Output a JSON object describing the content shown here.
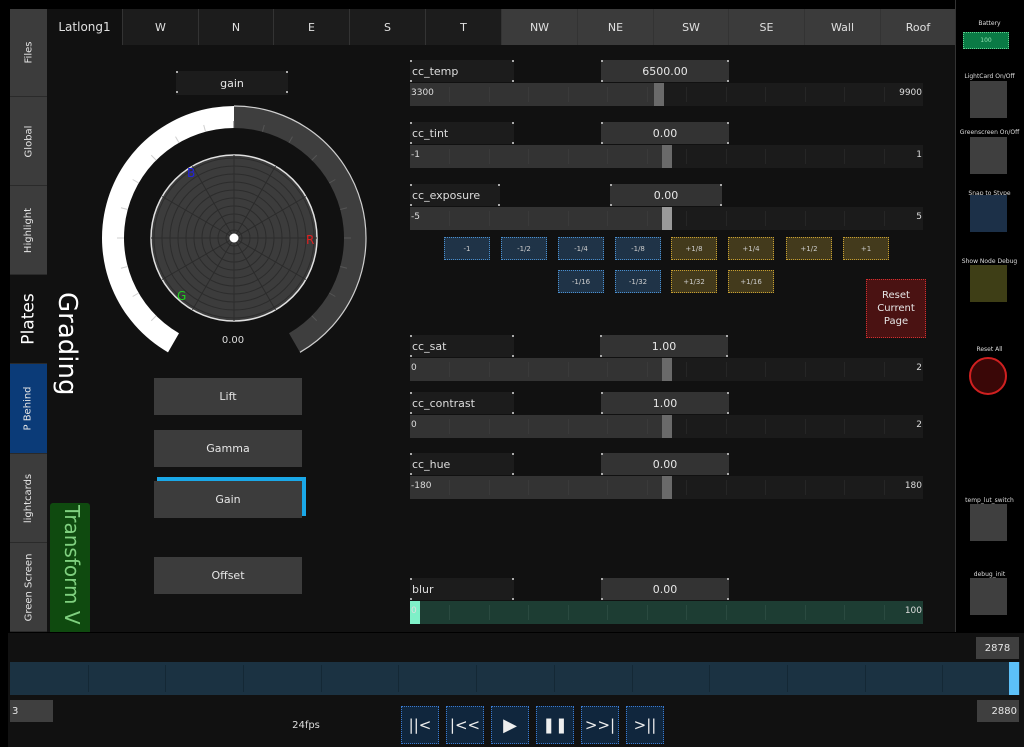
{
  "left_tabs": [
    {
      "label": "Files",
      "state": "normal"
    },
    {
      "label": "Global",
      "state": "normal"
    },
    {
      "label": "Highlight",
      "state": "normal"
    },
    {
      "label": "Plates",
      "state": "active"
    },
    {
      "label": "P Behind",
      "state": "selected"
    },
    {
      "label": "lightcards",
      "state": "normal"
    },
    {
      "label": "Green Screen",
      "state": "normal"
    }
  ],
  "top_tabs": [
    {
      "label": "Latlong1",
      "active": true
    },
    {
      "label": "W"
    },
    {
      "label": "N"
    },
    {
      "label": "E"
    },
    {
      "label": "S"
    },
    {
      "label": "T"
    },
    {
      "label": "NW"
    },
    {
      "label": "NE"
    },
    {
      "label": "SW"
    },
    {
      "label": "SE"
    },
    {
      "label": "Wall"
    },
    {
      "label": "Roof"
    }
  ],
  "section_titles": {
    "grading": "Grading",
    "transform": "Transform V"
  },
  "color_wheel": {
    "mode_label": "gain",
    "value": "0.00",
    "ring_fill_fraction": 0.5,
    "channel_labels": {
      "r": "R",
      "g": "G",
      "b": "B"
    },
    "channel_colors": {
      "r": "#e02020",
      "g": "#20d020",
      "b": "#2020e0"
    }
  },
  "grade_buttons": [
    {
      "label": "Lift",
      "selected": false
    },
    {
      "label": "Gamma",
      "selected": false
    },
    {
      "label": "Gain",
      "selected": true
    },
    {
      "label": "Offset",
      "selected": false
    }
  ],
  "sliders": [
    {
      "name": "cc_temp",
      "value": "6500.00",
      "min": "3300",
      "max": "9900",
      "fraction": 0.485
    },
    {
      "name": "cc_tint",
      "value": "0.00",
      "min": "-1",
      "max": "1",
      "fraction": 0.5
    },
    {
      "name": "cc_exposure",
      "value": "0.00",
      "min": "-5",
      "max": "5",
      "fraction": 0.5
    },
    {
      "name": "cc_sat",
      "value": "1.00",
      "min": "0",
      "max": "2",
      "fraction": 0.5
    },
    {
      "name": "cc_contrast",
      "value": "1.00",
      "min": "0",
      "max": "2",
      "fraction": 0.5
    },
    {
      "name": "cc_hue",
      "value": "0.00",
      "min": "-180",
      "max": "180",
      "fraction": 0.5
    },
    {
      "name": "blur",
      "value": "0.00",
      "min": "0",
      "max": "100",
      "fraction": 0.0
    }
  ],
  "exposure_steps": {
    "row1": [
      "-1",
      "-1/2",
      "-1/4",
      "-1/8",
      "+1/8",
      "+1/4",
      "+1/2",
      "+1"
    ],
    "row2": [
      "-1/16",
      "-1/32",
      "+1/32",
      "+1/16"
    ]
  },
  "reset_page_label": "Reset Current Page",
  "right_panel": {
    "battery_label": "Battery",
    "battery_value": "100",
    "buttons": [
      {
        "label": "LightCard On/Off"
      },
      {
        "label": "Greenscreen On/Off"
      },
      {
        "label": "Snap to Stype"
      },
      {
        "label": "Show Node Debug"
      },
      {
        "label": "Reset All"
      },
      {
        "label": "temp_lut_switch"
      },
      {
        "label": "debug_init"
      }
    ]
  },
  "timeline": {
    "current_frame": "2878",
    "start_frame": "3",
    "end_frame": "2880",
    "fps": "24fps",
    "playhead_fraction": 0.999
  },
  "transport": [
    {
      "label": "||<",
      "icon": "go-to-start-icon"
    },
    {
      "label": "|<<",
      "icon": "step-back-icon"
    },
    {
      "label": "▶",
      "icon": "play-icon"
    },
    {
      "label": "❚❚",
      "icon": "pause-icon"
    },
    {
      "label": ">>|",
      "icon": "step-forward-icon"
    },
    {
      "label": ">||",
      "icon": "go-to-end-icon"
    }
  ]
}
